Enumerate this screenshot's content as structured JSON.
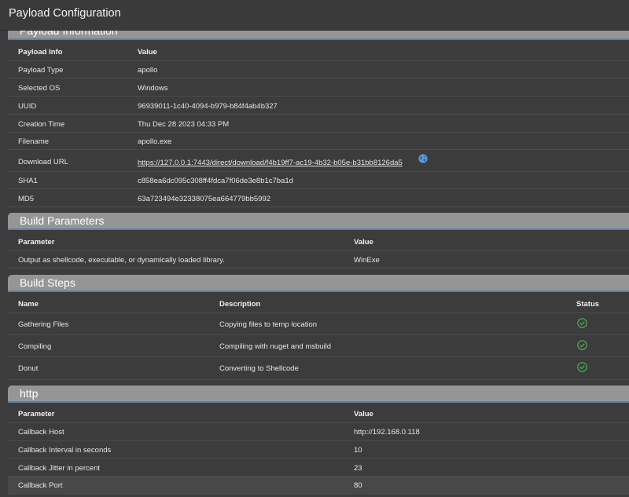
{
  "window": {
    "title": "Payload Configuration"
  },
  "payload_info": {
    "section_title": "Payload Information",
    "headers": {
      "key": "Payload Info",
      "value": "Value"
    },
    "rows": [
      {
        "key": "Payload Type",
        "value": "apollo"
      },
      {
        "key": "Selected OS",
        "value": "Windows"
      },
      {
        "key": "UUID",
        "value": "96939011-1c40-4094-b979-b84f4ab4b327"
      },
      {
        "key": "Creation Time",
        "value": "Thu Dec 28 2023 04:33 PM"
      },
      {
        "key": "Filename",
        "value": "apollo.exe"
      },
      {
        "key": "Download URL",
        "value": "https://127.0.0.1:7443/direct/download/f4b19ff7-ac19-4b32-b05e-b31bb8126da5",
        "icon": "globe-icon"
      },
      {
        "key": "SHA1",
        "value": "c858ea6dc095c308ff4fdca7f06de3e8b1c7ba1d"
      },
      {
        "key": "MD5",
        "value": "63a723494e32338075ea664779bb5992"
      }
    ]
  },
  "build_parameters": {
    "section_title": "Build Parameters",
    "headers": {
      "parameter": "Parameter",
      "value": "Value"
    },
    "rows": [
      {
        "parameter": "Output as shellcode, executable, or dynamically loaded library.",
        "value": "WinExe"
      }
    ]
  },
  "build_steps": {
    "section_title": "Build Steps",
    "headers": {
      "name": "Name",
      "description": "Description",
      "status": "Status"
    },
    "rows": [
      {
        "name": "Gathering Files",
        "description": "Copying files to temp location",
        "status_icon": "check-circle-icon"
      },
      {
        "name": "Compiling",
        "description": "Compiling with nuget and msbuild",
        "status_icon": "check-circle-icon"
      },
      {
        "name": "Donut",
        "description": "Converting to Shellcode",
        "status_icon": "check-circle-icon"
      }
    ]
  },
  "http": {
    "section_title": "http",
    "headers": {
      "parameter": "Parameter",
      "value": "Value"
    },
    "rows": [
      {
        "parameter": "Callback Host",
        "value": "http://192.168.0.118"
      },
      {
        "parameter": "Callback Interval in seconds",
        "value": "10"
      },
      {
        "parameter": "Callback Jitter in percent",
        "value": "23"
      },
      {
        "parameter": "Callback Port",
        "value": "80"
      }
    ]
  },
  "colors": {
    "background": "#3c3c3c",
    "section_header": "#959595",
    "accent_line": "#5b7fa6",
    "success": "#4caf50",
    "globe": "#5b9bd5"
  }
}
